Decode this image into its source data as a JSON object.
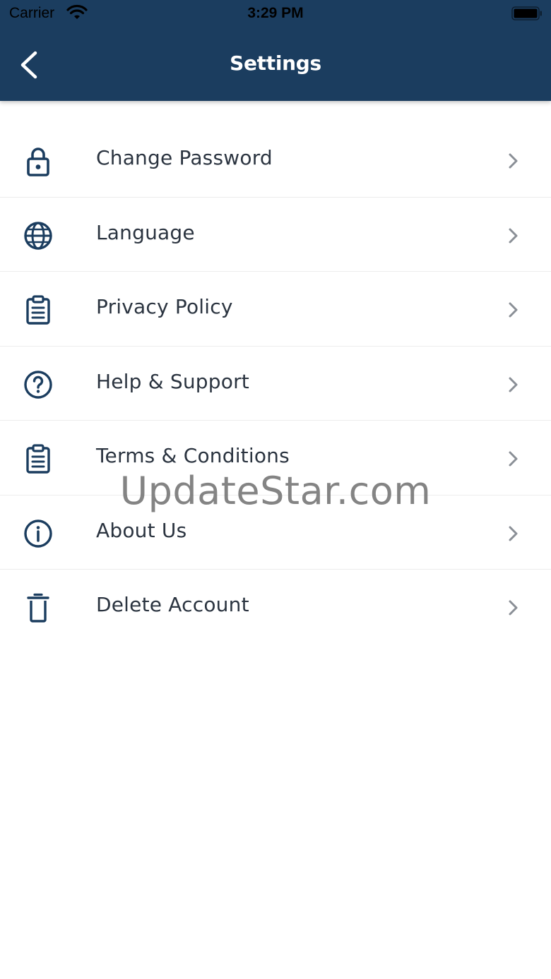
{
  "status_bar": {
    "carrier": "Carrier",
    "time": "3:29 PM"
  },
  "header": {
    "title": "Settings",
    "back_icon": "chevron-left-icon"
  },
  "settings": {
    "items": [
      {
        "label": "Change Password",
        "icon": "lock-icon"
      },
      {
        "label": "Language",
        "icon": "globe-icon"
      },
      {
        "label": "Privacy Policy",
        "icon": "clipboard-icon"
      },
      {
        "label": "Help & Support",
        "icon": "question-circle-icon"
      },
      {
        "label": "Terms & Conditions",
        "icon": "clipboard-icon"
      },
      {
        "label": "About Us",
        "icon": "info-circle-icon"
      },
      {
        "label": "Delete Account",
        "icon": "trash-icon"
      }
    ]
  },
  "watermark": "UpdateStar.com",
  "colors": {
    "header_bg": "#1b3d5f",
    "icon": "#1b3d5f",
    "text": "#2b3440",
    "chevron": "#8a8f96"
  }
}
